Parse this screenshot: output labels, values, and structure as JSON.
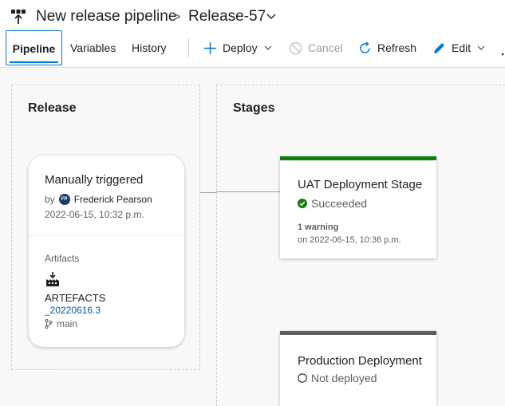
{
  "header": {
    "pipeline_name": "New release pipeline",
    "separator": ">",
    "release_name": "Release-57"
  },
  "toolbar": {
    "tabs": [
      {
        "label": "Pipeline",
        "active": true
      },
      {
        "label": "Variables",
        "active": false
      },
      {
        "label": "History",
        "active": false
      }
    ],
    "actions": {
      "deploy": "Deploy",
      "cancel": "Cancel",
      "refresh": "Refresh",
      "edit": "Edit"
    }
  },
  "release_section": {
    "heading": "Release",
    "card": {
      "trigger": "Manually triggered",
      "by_label": "by",
      "avatar_initials": "FP",
      "user": "Frederick Pearson",
      "date": "2022-06-15, 10:32 p.m.",
      "artifacts_label": "Artifacts",
      "artifact_name": "ARTEFACTS",
      "artifact_version": "_20220616.3",
      "branch": "main"
    }
  },
  "stages_section": {
    "heading": "Stages",
    "stages": [
      {
        "name": "UAT Deployment Stage",
        "status": "Succeeded",
        "warning": "1 warning",
        "when": "on 2022-06-15, 10:36 p.m."
      },
      {
        "name": "Production Deployment",
        "status": "Not deployed"
      }
    ]
  },
  "colors": {
    "accent": "#0078d4",
    "success": "#107c10",
    "not_deployed": "#605e5c",
    "link": "#005a9e"
  },
  "icons": {
    "pipeline": "pipeline-icon",
    "chevron": "chevron-down-icon",
    "add": "plus-icon",
    "cancel": "cancel-icon",
    "refresh": "refresh-icon",
    "edit": "pencil-icon",
    "artifact": "build-artifact-icon",
    "branch": "branch-icon",
    "success": "check-circle-icon",
    "not_deployed": "empty-circle-icon"
  }
}
